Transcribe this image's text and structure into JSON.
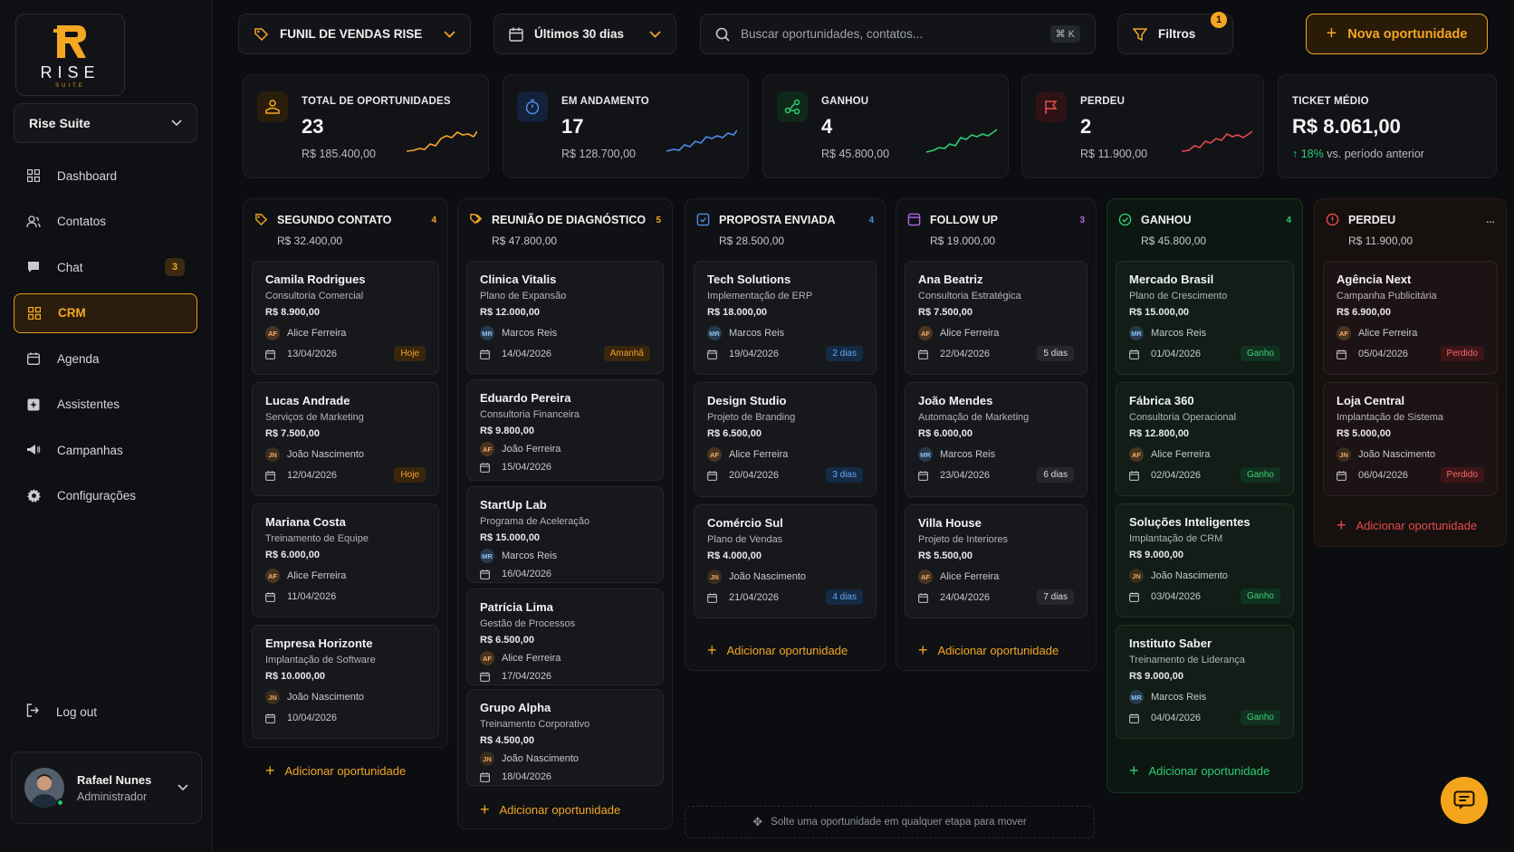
{
  "brand": {
    "logo_text": "RISE",
    "logo_sub": "SUITE"
  },
  "workspace": {
    "label": "Rise Suite"
  },
  "nav": [
    {
      "label": "Dashboard",
      "icon": "grid-icon"
    },
    {
      "label": "Contatos",
      "icon": "users-icon"
    },
    {
      "label": "Chat",
      "icon": "chat-icon",
      "badge": "3"
    },
    {
      "label": "CRM",
      "icon": "crm-icon",
      "active": true
    },
    {
      "label": "Agenda",
      "icon": "calendar-icon"
    },
    {
      "label": "Assistentes",
      "icon": "assistant-icon"
    },
    {
      "label": "Campanhas",
      "icon": "megaphone-icon"
    },
    {
      "label": "Configurações",
      "icon": "gear-icon"
    }
  ],
  "logout": {
    "label": "Log out"
  },
  "user": {
    "name": "Rafael Nunes",
    "role": "Administrador"
  },
  "topbar": {
    "pipeline": "FUNIL DE VENDAS RISE",
    "period": "Últimos 30 dias",
    "search_placeholder": "Buscar oportunidades, contatos...",
    "search_shortcut": "⌘ K",
    "filters": "Filtros",
    "filters_badge": "1",
    "new_button": "Nova oportunidade"
  },
  "stats": [
    {
      "label": "TOTAL DE OPORTUNIDADES",
      "value": "23",
      "sub": "R$ 185.400,00",
      "color": "#f5a623"
    },
    {
      "label": "EM ANDAMENTO",
      "value": "17",
      "sub": "R$ 128.700,00",
      "color": "#4d8fe8"
    },
    {
      "label": "GANHOU",
      "value": "4",
      "sub": "R$ 45.800,00",
      "color": "#2ecc71"
    },
    {
      "label": "PERDEU",
      "value": "2",
      "sub": "R$ 11.900,00",
      "color": "#e74c4c"
    },
    {
      "label": "TICKET MÉDIO",
      "value": "R$ 8.061,00",
      "trend": "18%",
      "trend_text": "vs. período anterior"
    }
  ],
  "columns": [
    {
      "title": "SEGUNDO CONTATO",
      "count": "4",
      "total": "R$ 32.400,00",
      "color": "#f5a623",
      "cards": [
        {
          "name": "Camila Rodrigues",
          "desc": "Consultoria Comercial",
          "value": "R$ 8.900,00",
          "ini": "AF",
          "owner": "Alice Ferreira",
          "date": "13/04/2026",
          "tag": "Hoje"
        },
        {
          "name": "Lucas Andrade",
          "desc": "Serviços de Marketing",
          "value": "R$ 7.500,00",
          "ini": "JN",
          "owner": "João Nascimento",
          "date": "12/04/2026",
          "tag": "Hoje"
        },
        {
          "name": "Mariana Costa",
          "desc": "Treinamento de Equipe",
          "value": "R$ 6.000,00",
          "ini": "AF",
          "owner": "Alice Ferreira",
          "date": "11/04/2026",
          "tag": ""
        },
        {
          "name": "Empresa Horizonte",
          "desc": "Implantação de Software",
          "value": "R$ 10.000,00",
          "ini": "JN",
          "owner": "João Nascimento",
          "date": "10/04/2026",
          "tag": ""
        }
      ],
      "add": "Adicionar oportunidade"
    },
    {
      "title": "REUNIÃO DE DIAGNÓSTICO",
      "count": "5",
      "total": "R$ 47.800,00",
      "color": "#f5a623",
      "cards": [
        {
          "name": "Clinica Vitalis",
          "desc": "Plano de Expansão",
          "value": "R$ 12.000,00",
          "ini": "MR",
          "owner": "Marcos Reis",
          "date": "14/04/2026",
          "tag": "Amanhã"
        },
        {
          "name": "Eduardo Pereira",
          "desc": "Consultoria Financeira",
          "value": "R$ 9.800,00",
          "ini": "AF",
          "owner": "João Ferreira",
          "date": "15/04/2026",
          "tag": ""
        },
        {
          "name": "StartUp Lab",
          "desc": "Programa de Aceleração",
          "value": "R$ 15.000,00",
          "ini": "MR",
          "owner": "Marcos Reis",
          "date": "16/04/2026",
          "tag": ""
        },
        {
          "name": "Patrícia Lima",
          "desc": "Gestão de Processos",
          "value": "R$ 6.500,00",
          "ini": "AF",
          "owner": "Alice Ferreira",
          "date": "17/04/2026",
          "tag": ""
        },
        {
          "name": "Grupo Alpha",
          "desc": "Treinamento Corporativo",
          "value": "R$ 4.500,00",
          "ini": "JN",
          "owner": "João Nascimento",
          "date": "18/04/2026",
          "tag": ""
        }
      ],
      "add": "Adicionar oportunidade"
    },
    {
      "title": "PROPOSTA ENVIADA",
      "count": "4",
      "total": "R$ 28.500,00",
      "color": "#4d8fe8",
      "cards": [
        {
          "name": "Tech Solutions",
          "desc": "Implementação de ERP",
          "value": "R$ 18.000,00",
          "ini": "MR",
          "owner": "Marcos Reis",
          "date": "19/04/2026",
          "tag": "2 dias"
        },
        {
          "name": "Design Studio",
          "desc": "Projeto de Branding",
          "value": "R$ 6.500,00",
          "ini": "AF",
          "owner": "Alice Ferreira",
          "date": "20/04/2026",
          "tag": "3 dias"
        },
        {
          "name": "Comércio Sul",
          "desc": "Plano de Vendas",
          "value": "R$ 4.000,00",
          "ini": "JN",
          "owner": "João Nascimento",
          "date": "21/04/2026",
          "tag": "4 dias"
        }
      ],
      "add": "Adicionar oportunidade"
    },
    {
      "title": "FOLLOW UP",
      "count": "3",
      "total": "R$ 19.000,00",
      "color": "#b06ae8",
      "cards": [
        {
          "name": "Ana Beatriz",
          "desc": "Consultoria Estratégica",
          "value": "R$ 7.500,00",
          "ini": "AF",
          "owner": "Alice Ferreira",
          "date": "22/04/2026",
          "tag": "5 dias"
        },
        {
          "name": "João Mendes",
          "desc": "Automação de Marketing",
          "value": "R$ 6.000,00",
          "ini": "MR",
          "owner": "Marcos Reis",
          "date": "23/04/2026",
          "tag": "6 dias"
        },
        {
          "name": "Villa House",
          "desc": "Projeto de Interiores",
          "value": "R$ 5.500,00",
          "ini": "AF",
          "owner": "Alice Ferreira",
          "date": "24/04/2026",
          "tag": "7 dias"
        }
      ],
      "add": "Adicionar oportunidade"
    },
    {
      "title": "GANHOU",
      "count": "4",
      "total": "R$ 45.800,00",
      "color": "#2ecc71",
      "cards": [
        {
          "name": "Mercado Brasil",
          "desc": "Plano de Crescimento",
          "value": "R$ 15.000,00",
          "ini": "MR",
          "owner": "Marcos Reis",
          "date": "01/04/2026",
          "tag": "Ganho"
        },
        {
          "name": "Fábrica 360",
          "desc": "Consultoria Operacional",
          "value": "R$ 12.800,00",
          "ini": "AF",
          "owner": "Alice Ferreira",
          "date": "02/04/2026",
          "tag": "Ganho"
        },
        {
          "name": "Soluções Inteligentes",
          "desc": "Implantação de CRM",
          "value": "R$ 9.000,00",
          "ini": "JN",
          "owner": "João Nascimento",
          "date": "03/04/2026",
          "tag": "Ganho"
        },
        {
          "name": "Instituto Saber",
          "desc": "Treinamento de Liderança",
          "value": "R$ 9.000,00",
          "ini": "MR",
          "owner": "Marcos Reis",
          "date": "04/04/2026",
          "tag": "Ganho"
        }
      ],
      "add": "Adicionar oportunidade"
    },
    {
      "title": "PERDEU",
      "count": "…",
      "total": "R$ 11.900,00",
      "color": "#e74c4c",
      "cards": [
        {
          "name": "Agência Next",
          "desc": "Campanha Publicitária",
          "value": "R$ 6.900,00",
          "ini": "AF",
          "owner": "Alice Ferreira",
          "date": "05/04/2026",
          "tag": "Perdido"
        },
        {
          "name": "Loja Central",
          "desc": "Implantação de Sistema",
          "value": "R$ 5.000,00",
          "ini": "JN",
          "owner": "João Nascimento",
          "date": "06/04/2026",
          "tag": "Perdido"
        }
      ],
      "add": "Adicionar oportunidade"
    }
  ],
  "drop_hint": "Solte uma oportunidade em qualquer etapa para mover"
}
